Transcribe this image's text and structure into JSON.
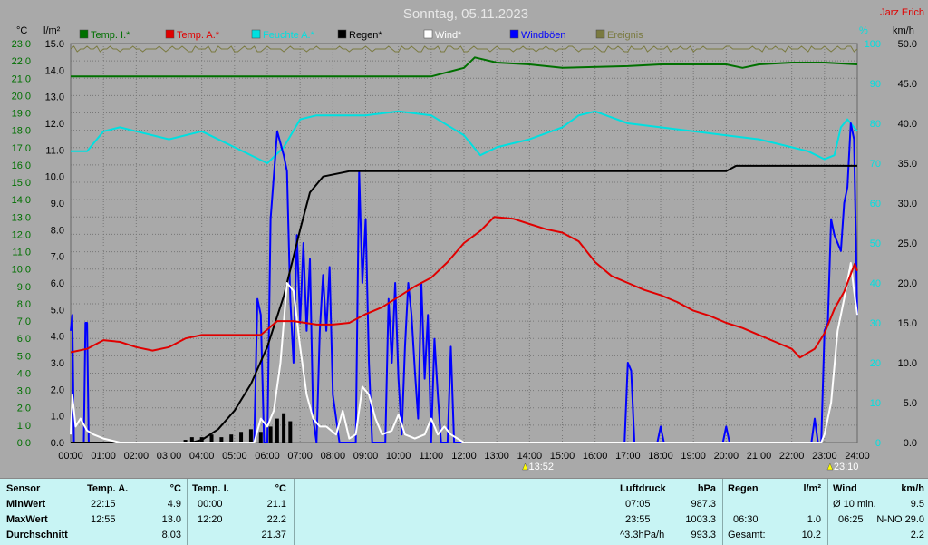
{
  "title": "Sonntag, 05.11.2023",
  "author": "Jarz Erich",
  "axis_units": {
    "left1": "°C",
    "left2": "l/m²",
    "right1": "%",
    "right2": "km/h"
  },
  "legend": [
    {
      "label": "Temp. I.*",
      "color": "#007000"
    },
    {
      "label": "Temp. A.*",
      "color": "#e00000"
    },
    {
      "label": "Feuchte A.*",
      "color": "#00e0e0"
    },
    {
      "label": "Regen*",
      "color": "#000000"
    },
    {
      "label": "Wind*",
      "color": "#ffffff"
    },
    {
      "label": "Windböen",
      "color": "#0000ff"
    },
    {
      "label": "Ereignis",
      "color": "#7a7a40"
    }
  ],
  "markers": [
    {
      "label": "13:52"
    },
    {
      "label": "23:10"
    }
  ],
  "chart_data": {
    "type": "line",
    "x_ticks": [
      "00:00",
      "01:00",
      "02:00",
      "03:00",
      "04:00",
      "05:00",
      "06:00",
      "07:00",
      "08:00",
      "09:00",
      "10:00",
      "11:00",
      "12:00",
      "13:00",
      "14:00",
      "15:00",
      "16:00",
      "17:00",
      "18:00",
      "19:00",
      "20:00",
      "21:00",
      "22:00",
      "23:00",
      "24:00"
    ],
    "temp_ticks": [
      "23.0",
      "22.0",
      "21.0",
      "20.0",
      "19.0",
      "18.0",
      "17.0",
      "16.0",
      "15.0",
      "14.0",
      "13.0",
      "12.0",
      "11.0",
      "10.0",
      "9.0",
      "8.0",
      "7.0",
      "6.0",
      "5.0",
      "4.0",
      "3.0",
      "2.0",
      "1.0",
      "0.0"
    ],
    "rain_ticks": [
      "15.0",
      "14.0",
      "13.0",
      "12.0",
      "11.0",
      "10.0",
      "9.0",
      "8.0",
      "7.0",
      "6.0",
      "5.0",
      "4.0",
      "3.0",
      "2.0",
      "1.0",
      "0.0"
    ],
    "hum_ticks": [
      "100",
      "90",
      "80",
      "70",
      "60",
      "50",
      "40",
      "30",
      "20",
      "10",
      "0"
    ],
    "wind_ticks": [
      "50.0",
      "45.0",
      "40.0",
      "35.0",
      "30.0",
      "25.0",
      "20.0",
      "15.0",
      "10.0",
      "5.0",
      "0.0"
    ],
    "ranges": {
      "temp": [
        0,
        23
      ],
      "rain": [
        0,
        15
      ],
      "humidity": [
        0,
        100
      ],
      "wind": [
        0,
        50
      ]
    },
    "series": [
      {
        "name": "Temp. I.*",
        "unit": "°C",
        "color": "#007000",
        "points": [
          [
            0,
            21.1
          ],
          [
            2,
            21.1
          ],
          [
            4,
            21.1
          ],
          [
            6,
            21.1
          ],
          [
            8,
            21.1
          ],
          [
            11,
            21.1
          ],
          [
            12,
            21.6
          ],
          [
            12.33,
            22.2
          ],
          [
            13,
            21.9
          ],
          [
            14,
            21.8
          ],
          [
            15,
            21.6
          ],
          [
            17,
            21.7
          ],
          [
            18,
            21.8
          ],
          [
            20,
            21.8
          ],
          [
            20.5,
            21.6
          ],
          [
            21,
            21.8
          ],
          [
            22,
            21.9
          ],
          [
            23,
            21.9
          ],
          [
            24,
            21.8
          ]
        ]
      },
      {
        "name": "Temp. A.*",
        "unit": "°C",
        "color": "#e00000",
        "points": [
          [
            0,
            5.2
          ],
          [
            0.5,
            5.4
          ],
          [
            1,
            5.9
          ],
          [
            1.5,
            5.8
          ],
          [
            2,
            5.5
          ],
          [
            2.5,
            5.3
          ],
          [
            3,
            5.5
          ],
          [
            3.5,
            6.0
          ],
          [
            4,
            6.2
          ],
          [
            5,
            6.2
          ],
          [
            5.8,
            6.2
          ],
          [
            6.3,
            7.0
          ],
          [
            6.8,
            7.0
          ],
          [
            7.5,
            6.8
          ],
          [
            8,
            6.8
          ],
          [
            8.5,
            6.9
          ],
          [
            9,
            7.4
          ],
          [
            9.5,
            7.8
          ],
          [
            10,
            8.4
          ],
          [
            10.5,
            9.0
          ],
          [
            11,
            9.5
          ],
          [
            11.5,
            10.4
          ],
          [
            12,
            11.5
          ],
          [
            12.5,
            12.2
          ],
          [
            12.92,
            13.0
          ],
          [
            13.5,
            12.9
          ],
          [
            14,
            12.6
          ],
          [
            14.5,
            12.3
          ],
          [
            15,
            12.1
          ],
          [
            15.5,
            11.6
          ],
          [
            16,
            10.4
          ],
          [
            16.5,
            9.6
          ],
          [
            17,
            9.2
          ],
          [
            17.5,
            8.8
          ],
          [
            18,
            8.5
          ],
          [
            18.5,
            8.1
          ],
          [
            19,
            7.6
          ],
          [
            19.5,
            7.3
          ],
          [
            20,
            6.9
          ],
          [
            20.5,
            6.6
          ],
          [
            21,
            6.2
          ],
          [
            21.5,
            5.8
          ],
          [
            22,
            5.4
          ],
          [
            22.25,
            4.9
          ],
          [
            22.7,
            5.4
          ],
          [
            23,
            6.3
          ],
          [
            23.3,
            7.7
          ],
          [
            23.6,
            8.7
          ],
          [
            23.92,
            10.3
          ],
          [
            24,
            9.9
          ]
        ]
      },
      {
        "name": "Feuchte A.*",
        "unit": "%",
        "color": "#00e0e0",
        "points": [
          [
            0,
            73
          ],
          [
            0.5,
            73
          ],
          [
            1,
            78
          ],
          [
            1.5,
            79
          ],
          [
            2,
            78
          ],
          [
            3,
            76
          ],
          [
            4,
            78
          ],
          [
            5,
            74
          ],
          [
            6,
            70
          ],
          [
            6.5,
            74
          ],
          [
            7,
            81
          ],
          [
            7.5,
            82
          ],
          [
            8,
            82
          ],
          [
            9,
            82
          ],
          [
            10,
            83
          ],
          [
            11,
            82
          ],
          [
            12,
            77
          ],
          [
            12.5,
            72
          ],
          [
            13,
            74
          ],
          [
            14,
            76
          ],
          [
            15,
            79
          ],
          [
            15.5,
            82
          ],
          [
            16,
            83
          ],
          [
            17,
            80
          ],
          [
            18,
            79
          ],
          [
            19,
            78
          ],
          [
            20,
            77
          ],
          [
            21,
            76
          ],
          [
            22,
            74
          ],
          [
            22.5,
            73
          ],
          [
            23,
            71
          ],
          [
            23.3,
            72
          ],
          [
            23.5,
            79
          ],
          [
            23.7,
            81
          ],
          [
            24,
            78
          ]
        ]
      },
      {
        "name": "Regen*",
        "unit": "l/m²",
        "color": "#000000",
        "points": [
          [
            0,
            0
          ],
          [
            3.7,
            0
          ],
          [
            4,
            0.1
          ],
          [
            4.5,
            0.5
          ],
          [
            5,
            1.2
          ],
          [
            5.5,
            2.2
          ],
          [
            6,
            3.6
          ],
          [
            6.5,
            5.5
          ],
          [
            7,
            8.0
          ],
          [
            7.3,
            9.4
          ],
          [
            7.7,
            10.0
          ],
          [
            8.5,
            10.2
          ],
          [
            10,
            10.2
          ],
          [
            16,
            10.2
          ],
          [
            19,
            10.2
          ],
          [
            20,
            10.2
          ],
          [
            20.3,
            10.4
          ],
          [
            20.6,
            10.4
          ],
          [
            24,
            10.4
          ]
        ]
      },
      {
        "name": "Wind*",
        "unit": "km/h",
        "color": "#ffffff",
        "points": [
          [
            0,
            1
          ],
          [
            0.05,
            6
          ],
          [
            0.15,
            2
          ],
          [
            0.3,
            3
          ],
          [
            0.5,
            1.5
          ],
          [
            0.7,
            1
          ],
          [
            1,
            0.5
          ],
          [
            1.5,
            0
          ],
          [
            5.6,
            0
          ],
          [
            5.8,
            3
          ],
          [
            6.0,
            2
          ],
          [
            6.2,
            4
          ],
          [
            6.4,
            10
          ],
          [
            6.6,
            20
          ],
          [
            6.8,
            19
          ],
          [
            7.0,
            12
          ],
          [
            7.2,
            6
          ],
          [
            7.4,
            3
          ],
          [
            7.6,
            2
          ],
          [
            7.8,
            2
          ],
          [
            8.1,
            1
          ],
          [
            8.3,
            4
          ],
          [
            8.5,
            0.5
          ],
          [
            8.7,
            1
          ],
          [
            8.9,
            7
          ],
          [
            9.1,
            6
          ],
          [
            9.3,
            3
          ],
          [
            9.5,
            1
          ],
          [
            9.8,
            1.5
          ],
          [
            10.0,
            3.5
          ],
          [
            10.2,
            1
          ],
          [
            10.5,
            0.5
          ],
          [
            10.8,
            1
          ],
          [
            11.0,
            3
          ],
          [
            11.2,
            1
          ],
          [
            11.4,
            2
          ],
          [
            11.6,
            1
          ],
          [
            11.8,
            0.5
          ],
          [
            12,
            0
          ],
          [
            22.9,
            0
          ],
          [
            23.0,
            1
          ],
          [
            23.2,
            5
          ],
          [
            23.4,
            14
          ],
          [
            23.6,
            18
          ],
          [
            23.8,
            22.5
          ],
          [
            23.9,
            19
          ],
          [
            24,
            16
          ]
        ]
      },
      {
        "name": "Windböen",
        "unit": "km/h",
        "color": "#0000ff",
        "points": [
          [
            0,
            14
          ],
          [
            0.05,
            16
          ],
          [
            0.1,
            0
          ],
          [
            0.4,
            0
          ],
          [
            0.45,
            15
          ],
          [
            0.5,
            15
          ],
          [
            0.55,
            0
          ],
          [
            5.6,
            0
          ],
          [
            5.7,
            18
          ],
          [
            5.8,
            16
          ],
          [
            5.9,
            0
          ],
          [
            6.0,
            0
          ],
          [
            6.1,
            28
          ],
          [
            6.3,
            39
          ],
          [
            6.5,
            36
          ],
          [
            6.6,
            34
          ],
          [
            6.7,
            18
          ],
          [
            6.8,
            10
          ],
          [
            6.9,
            26
          ],
          [
            7.0,
            15
          ],
          [
            7.1,
            25
          ],
          [
            7.2,
            14
          ],
          [
            7.3,
            23
          ],
          [
            7.4,
            3
          ],
          [
            7.5,
            0
          ],
          [
            7.6,
            14
          ],
          [
            7.7,
            21
          ],
          [
            7.8,
            14
          ],
          [
            7.9,
            22
          ],
          [
            8.0,
            6
          ],
          [
            8.2,
            0
          ],
          [
            8.7,
            0
          ],
          [
            8.8,
            34
          ],
          [
            8.9,
            20
          ],
          [
            9.0,
            28
          ],
          [
            9.1,
            10
          ],
          [
            9.2,
            0
          ],
          [
            9.6,
            0
          ],
          [
            9.7,
            18
          ],
          [
            9.8,
            10
          ],
          [
            9.9,
            20
          ],
          [
            10.0,
            8
          ],
          [
            10.1,
            1
          ],
          [
            10.2,
            12
          ],
          [
            10.3,
            20
          ],
          [
            10.4,
            16
          ],
          [
            10.5,
            9
          ],
          [
            10.6,
            3
          ],
          [
            10.7,
            20
          ],
          [
            10.8,
            8
          ],
          [
            10.9,
            16
          ],
          [
            11.0,
            0
          ],
          [
            11.1,
            13
          ],
          [
            11.2,
            6
          ],
          [
            11.3,
            0
          ],
          [
            11.5,
            0
          ],
          [
            11.6,
            12
          ],
          [
            11.7,
            0
          ],
          [
            16.9,
            0
          ],
          [
            17.0,
            10
          ],
          [
            17.1,
            9
          ],
          [
            17.2,
            0
          ],
          [
            17.9,
            0
          ],
          [
            18.0,
            2
          ],
          [
            18.1,
            0
          ],
          [
            19.9,
            0
          ],
          [
            20.0,
            2
          ],
          [
            20.1,
            0
          ],
          [
            22.6,
            0
          ],
          [
            22.7,
            3
          ],
          [
            22.8,
            0
          ],
          [
            22.9,
            0
          ],
          [
            23.0,
            14
          ],
          [
            23.1,
            15
          ],
          [
            23.2,
            28
          ],
          [
            23.3,
            26
          ],
          [
            23.5,
            24
          ],
          [
            23.6,
            30
          ],
          [
            23.7,
            32
          ],
          [
            23.8,
            40
          ],
          [
            23.9,
            38
          ],
          [
            24,
            16
          ]
        ]
      }
    ],
    "rain_bars": [
      [
        3.5,
        0.1
      ],
      [
        3.7,
        0.2
      ],
      [
        4.0,
        0.2
      ],
      [
        4.3,
        0.3
      ],
      [
        4.6,
        0.2
      ],
      [
        4.9,
        0.3
      ],
      [
        5.2,
        0.4
      ],
      [
        5.5,
        0.5
      ],
      [
        5.8,
        0.4
      ],
      [
        6.1,
        0.6
      ],
      [
        6.3,
        0.9
      ],
      [
        6.5,
        1.1
      ],
      [
        6.7,
        0.8
      ]
    ]
  },
  "stats": {
    "sensor_label": "Sensor",
    "rows": [
      "MinWert",
      "MaxWert",
      "Durchschnitt"
    ],
    "temp_a": {
      "header": "Temp. A.",
      "unit": "°C",
      "min_time": "22:15",
      "min": "4.9",
      "max_time": "12:55",
      "max": "13.0",
      "avg": "8.03"
    },
    "temp_i": {
      "header": "Temp. I.",
      "unit": "°C",
      "min_time": "00:00",
      "min": "21.1",
      "max_time": "12:20",
      "max": "22.2",
      "avg": "21.37"
    },
    "pressure": {
      "header": "Luftdruck",
      "unit": "hPa",
      "min_time": "07:05",
      "min": "987.3",
      "max_time": "23:55",
      "max": "1003.3",
      "avg_label": "^3.3hPa/h",
      "avg": "993.3"
    },
    "rain": {
      "header": "Regen",
      "unit": "l/m²",
      "max_time": "06:30",
      "max": "1.0",
      "avg_label": "Gesamt:",
      "avg": "10.2"
    },
    "wind": {
      "header": "Wind",
      "unit": "km/h",
      "min_label": "Ø 10 min.",
      "min": "9.5",
      "max_time": "06:25",
      "max": "N-NO 29.0",
      "avg": "2.2"
    }
  }
}
